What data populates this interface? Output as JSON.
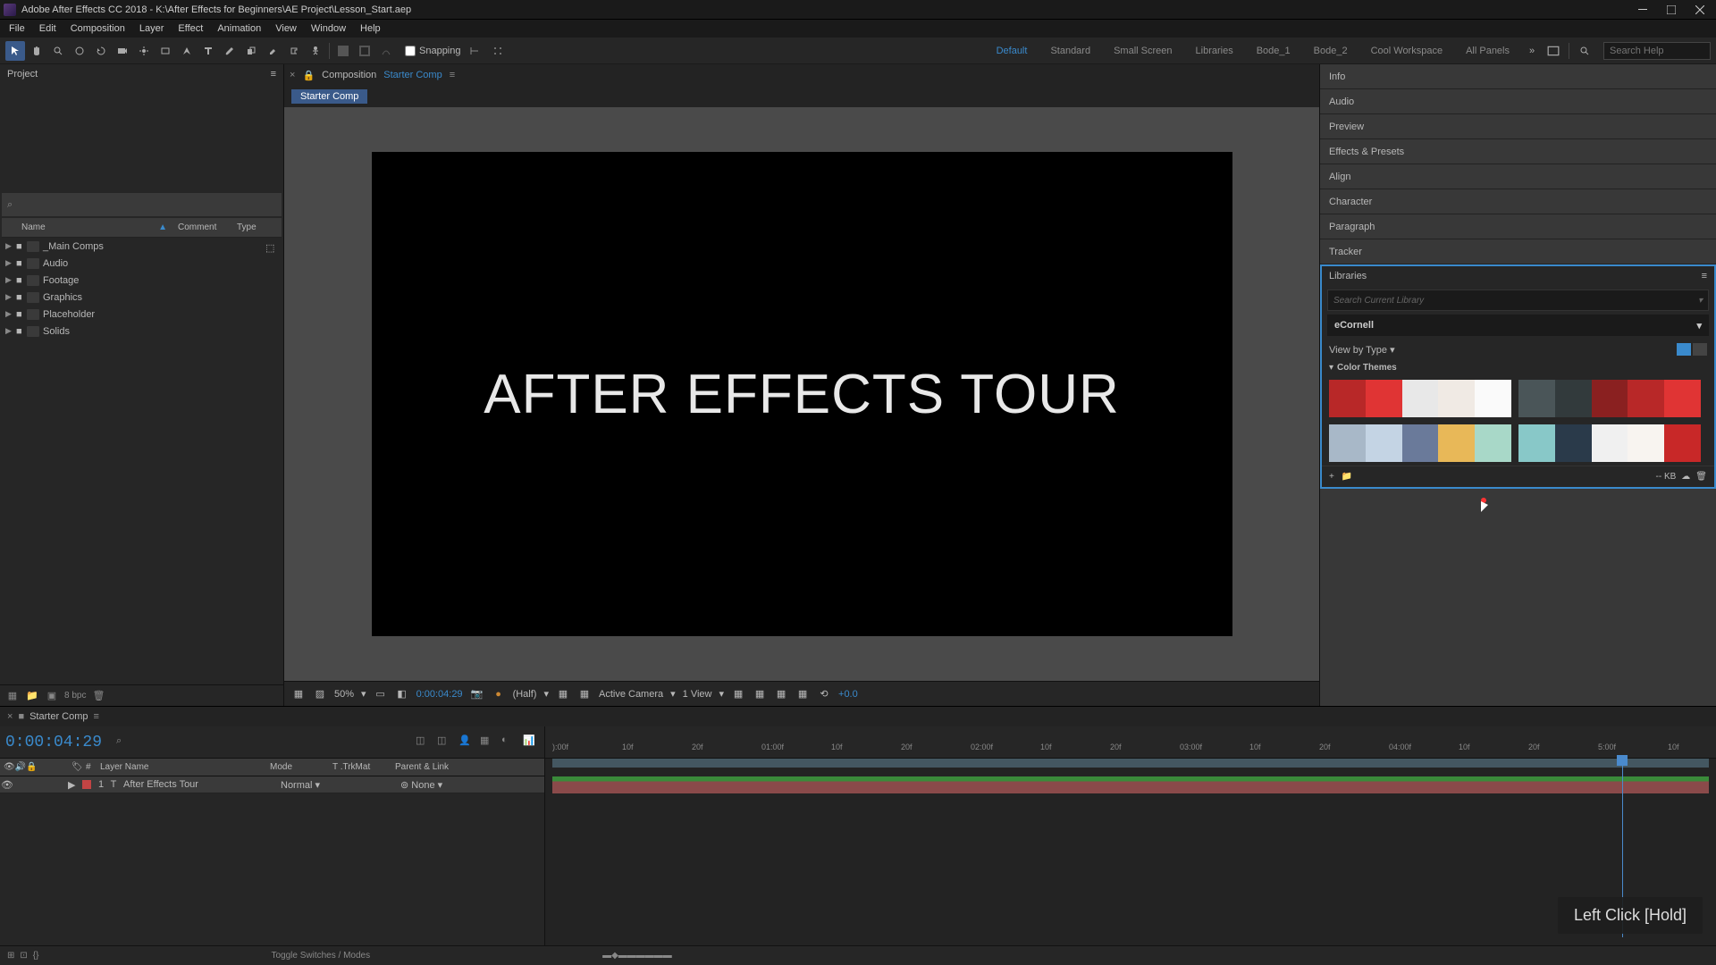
{
  "titlebar": {
    "title": "Adobe After Effects CC 2018 - K:\\After Effects for Beginners\\AE Project\\Lesson_Start.aep"
  },
  "menubar": {
    "items": [
      "File",
      "Edit",
      "Composition",
      "Layer",
      "Effect",
      "Animation",
      "View",
      "Window",
      "Help"
    ]
  },
  "toolbar": {
    "snapping_label": "Snapping",
    "workspaces": [
      "Default",
      "Standard",
      "Small Screen",
      "Libraries",
      "Bode_1",
      "Bode_2",
      "Cool Workspace",
      "All Panels"
    ],
    "active_workspace": "Default",
    "search_placeholder": "Search Help"
  },
  "project_panel": {
    "title": "Project",
    "headers": {
      "name": "Name",
      "comment": "Comment",
      "type": "Type"
    },
    "items": [
      {
        "name": "_Main Comps"
      },
      {
        "name": "Audio"
      },
      {
        "name": "Footage"
      },
      {
        "name": "Graphics"
      },
      {
        "name": "Placeholder"
      },
      {
        "name": "Solids"
      }
    ],
    "bpc": "8 bpc"
  },
  "composition": {
    "tab_label": "Composition",
    "tab_name": "Starter Comp",
    "flow_tab": "Starter Comp",
    "canvas_text": "AFTER EFFECTS TOUR",
    "footer": {
      "zoom": "50%",
      "timecode": "0:00:04:29",
      "resolution": "(Half)",
      "camera": "Active Camera",
      "views": "1 View",
      "exposure": "+0.0"
    }
  },
  "right_panels": {
    "collapsed": [
      "Info",
      "Audio",
      "Preview",
      "Effects & Presets",
      "Align",
      "Character",
      "Paragraph",
      "Tracker"
    ],
    "libraries": {
      "title": "Libraries",
      "search_placeholder": "Search Current Library",
      "dropdown": "eCornell",
      "viewby": "View by Type",
      "section": "Color Themes",
      "themes": [
        [
          "#b82828",
          "#e03434",
          "#e8e8e8",
          "#f0eae4",
          "#fafafa"
        ],
        [
          "#4a5558",
          "#323a3c",
          "#8a2020",
          "#b82828",
          "#e03434"
        ],
        [
          "#a8b8c8",
          "#c4d4e4",
          "#6a7a9a",
          "#e8b858",
          "#a8d8c8"
        ],
        [
          "#88c8c8",
          "#2a3a4a",
          "#f0f0f0",
          "#f8f4f0",
          "#c82828"
        ]
      ],
      "kb_label": "-- KB"
    }
  },
  "timeline": {
    "tab": "Starter Comp",
    "timecode": "0:00:04:29",
    "headers": {
      "layer": "Layer Name",
      "mode": "Mode",
      "trkmat": "T  .TrkMat",
      "parent": "Parent & Link"
    },
    "layer": {
      "num": "1",
      "type": "T",
      "name": "After Effects Tour",
      "mode": "Normal",
      "parent": "None"
    },
    "ruler_ticks": [
      "):00f",
      "10f",
      "20f",
      "01:00f",
      "10f",
      "20f",
      "02:00f",
      "10f",
      "20f",
      "03:00f",
      "10f",
      "20f",
      "04:00f",
      "10f",
      "20f",
      "5:00f",
      "10f"
    ],
    "footer_text": "Toggle Switches / Modes"
  },
  "tooltip": {
    "text": "Left Click [Hold]"
  }
}
